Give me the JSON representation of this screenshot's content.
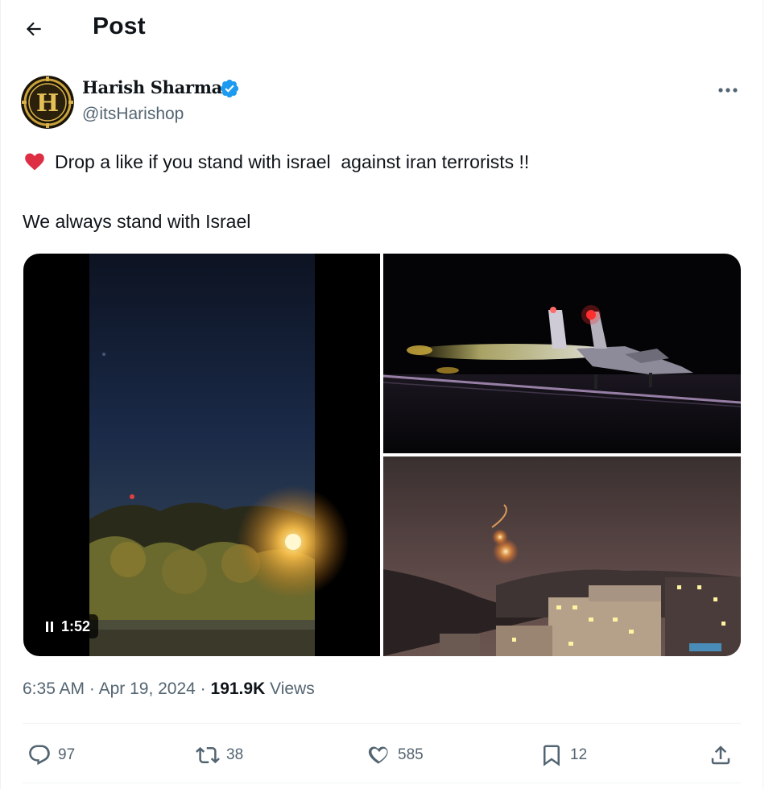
{
  "header": {
    "title": "Post",
    "back_label": "Back"
  },
  "author": {
    "name": "Harish Sharma",
    "handle": "@itsHarishop",
    "avatar_letter": "H",
    "verified": true
  },
  "post": {
    "line1": "Drop a like if you stand with israel  against iran terrorists !!",
    "line2": "We always stand with Israel",
    "emoji": "heart-icon"
  },
  "media": {
    "video_duration": "1:52",
    "video_state": "playing"
  },
  "meta": {
    "time": "6:35 AM",
    "separator": " · ",
    "date": "Apr 19, 2024",
    "views_count": "191.9K",
    "views_label": " Views"
  },
  "actions": {
    "replies": "97",
    "reposts": "38",
    "likes": "585",
    "bookmarks": "12"
  },
  "colors": {
    "text_primary": "#0f1419",
    "text_secondary": "#536471",
    "verified_blue": "#1d9bf0",
    "heart_red": "#e0245e",
    "divider": "#eff3f4"
  }
}
